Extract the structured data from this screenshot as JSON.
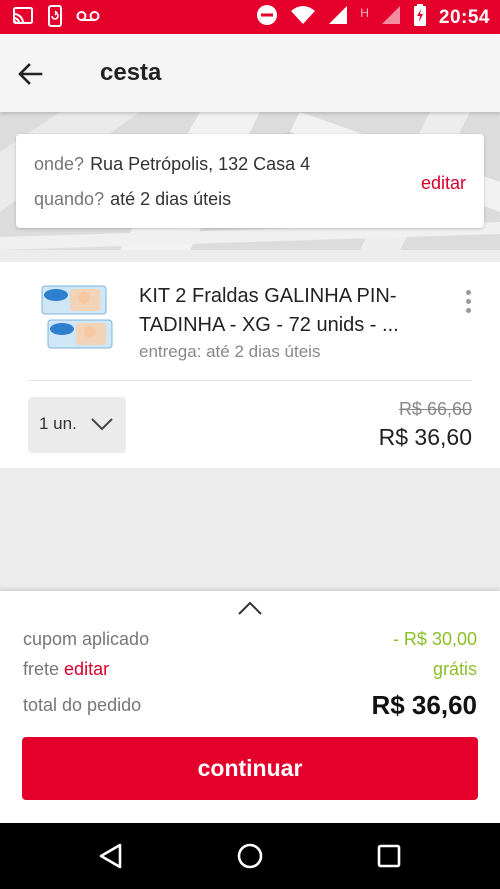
{
  "status_bar": {
    "time": "20:54",
    "network_letter": "H",
    "icons": [
      "cast-icon",
      "device-sync-icon",
      "voicemail-icon",
      "do-not-disturb-icon",
      "wifi-icon",
      "signal-icon",
      "battery-charging-icon"
    ]
  },
  "header": {
    "title": "cesta",
    "back_icon": "arrow-left-icon"
  },
  "delivery": {
    "where_label": "onde?",
    "where_value": "Rua Petrópolis, 132 Casa 4",
    "when_label": "quando?",
    "when_value": "até 2 dias úteis",
    "edit_label": "editar"
  },
  "product": {
    "name": "KIT 2 Fraldas GALINHA PIN-TADINHA - XG - 72 unids - ...",
    "delivery": "entrega: até 2 dias úteis",
    "quantity": "1 un.",
    "old_price": "R$ 66,60",
    "price": "R$ 36,60"
  },
  "summary": {
    "coupon_label": "cupom aplicado",
    "coupon_value": "- R$ 30,00",
    "freight_label": "frete",
    "freight_edit": "editar",
    "freight_value": "grátis",
    "total_label": "total do pedido",
    "total_value": "R$ 36,60",
    "continue_label": "continuar"
  },
  "colors": {
    "brand_red": "#e4002b",
    "success_green": "#8bbf2a"
  }
}
